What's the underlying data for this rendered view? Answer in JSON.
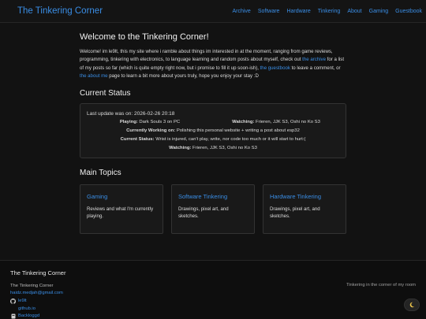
{
  "header": {
    "site_title": "The Tinkering Corner",
    "nav": [
      "Archive",
      "Software",
      "Hardware",
      "Tinkering",
      "About",
      "Gaming",
      "Guestbook"
    ]
  },
  "main": {
    "title": "Welcome to the Tinkering Corner!",
    "intro": {
      "part1": "Welcome! im le9lt, this my site where i ramble about things im interested in at the moment, ranging from game reviews, programming, tinkering with electronics, to language learning and random posts about myself, check out ",
      "link_archive": "the archive",
      "part2": " for a list of my posts so far (which is quite empty right now, but i promise to fill it up soon-ish), ",
      "link_guestbook": "the guestbook",
      "part3": " to leave a comment, or ",
      "link_about": "the about me",
      "part4": " page to learn a bit more about yours truly, hope you enjoy your stay :D"
    },
    "status": {
      "heading": "Current Status",
      "last_update": "Last update was on: 2026-02-26 20:18",
      "playing_label": "Playing:",
      "playing_value": "Dark Souls 3 on PC",
      "watching_label": "Watching:",
      "watching_value": "Frieren, JJK S3, Oshi no Ko S3",
      "working_label": "Currently Working on:",
      "working_value": "Polishing this personal website + writing a post about esp32",
      "current_label": "Current Status:",
      "current_value": "Wrist is injured, can't play, write, nor code too much or it will start to hurt:(",
      "watching2_label": "Watching:",
      "watching2_value": "Frieren, JJK S3, Oshi no Ko S3"
    },
    "topics": {
      "heading": "Main Topics",
      "cards": [
        {
          "title": "Gaming",
          "desc": "Reviews and what I'm currently playing."
        },
        {
          "title": "Software Tinkering",
          "desc": "Drawings, pixel art, and sketches."
        },
        {
          "title": "Hardware Tinkering",
          "desc": "Drawings, pixel art, and sketches."
        }
      ]
    }
  },
  "footer": {
    "title": "The Tinkering Corner",
    "name": "The Tinkering Corner",
    "email": "haidz.medjah@gmail.com",
    "links": [
      {
        "icon": "github-icon",
        "label": "le9lt"
      },
      {
        "icon": "",
        "label": "github.io"
      },
      {
        "icon": "backloggd-icon",
        "label": "Backloggd"
      }
    ],
    "tagline": "Tinkering in the corner of my room",
    "theme_icon": "moon-icon"
  },
  "colors": {
    "accent": "#3a8ee6",
    "background": "#121212",
    "panel": "#191919",
    "border": "#333333"
  }
}
